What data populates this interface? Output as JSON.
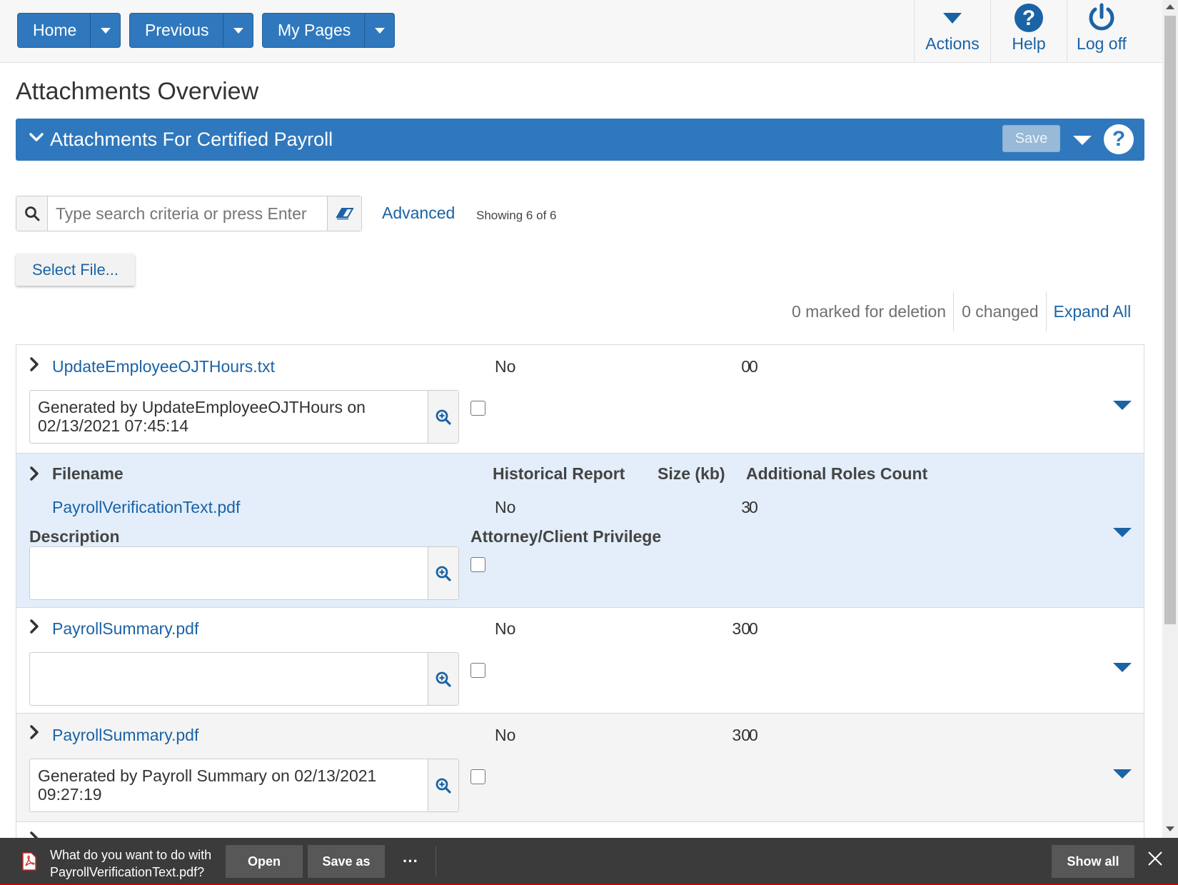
{
  "nav": {
    "home_label": "Home",
    "previous_label": "Previous",
    "mypages_label": "My Pages"
  },
  "top_actions": {
    "actions_label": "Actions",
    "help_label": "Help",
    "logoff_label": "Log off"
  },
  "page_title": "Attachments Overview",
  "panel": {
    "title": "Attachments For Certified Payroll",
    "save_label": "Save",
    "help_glyph": "?"
  },
  "search": {
    "placeholder": "Type search criteria or press Enter",
    "advanced_label": "Advanced",
    "showing_text": "Showing 6 of 6"
  },
  "select_file_label": "Select File...",
  "counters": {
    "marked_for_deletion": "0 marked for deletion",
    "changed": "0 changed",
    "expand_all": "Expand All"
  },
  "columns": {
    "filename": "Filename",
    "historical_report": "Historical Report",
    "size_kb": "Size (kb)",
    "additional_roles_count": "Additional Roles Count",
    "description": "Description",
    "attorney_client_privilege": "Attorney/Client Privilege"
  },
  "rows": [
    {
      "filename": "UpdateEmployeeOJTHours.txt",
      "historical": "No",
      "size": "0",
      "roles": "0",
      "description": "Generated by UpdateEmployeeOJTHours on 02/13/2021 07:45:14",
      "privilege": false
    },
    {
      "filename": "PayrollVerificationText.pdf",
      "historical": "No",
      "size": "3",
      "roles": "0",
      "description": "",
      "privilege": false
    },
    {
      "filename": "PayrollSummary.pdf",
      "historical": "No",
      "size": "30",
      "roles": "0",
      "description": "",
      "privilege": false
    },
    {
      "filename": "PayrollSummary.pdf",
      "historical": "No",
      "size": "30",
      "roles": "0",
      "description": "Generated by Payroll Summary on 02/13/2021 09:27:19",
      "privilege": false
    }
  ],
  "download_bar": {
    "prompt_line1": "What do you want to do with",
    "prompt_line2": "PayrollVerificationText.pdf?",
    "open_label": "Open",
    "save_as_label": "Save as",
    "more_label": "···",
    "show_all_label": "Show all"
  },
  "colors": {
    "brand_blue": "#2f78bd",
    "link_blue": "#1a63a6",
    "selected_row_bg": "#e3eefa",
    "alt_row_bg": "#f4f4f4",
    "download_bar_bg": "#3b3b3b"
  }
}
